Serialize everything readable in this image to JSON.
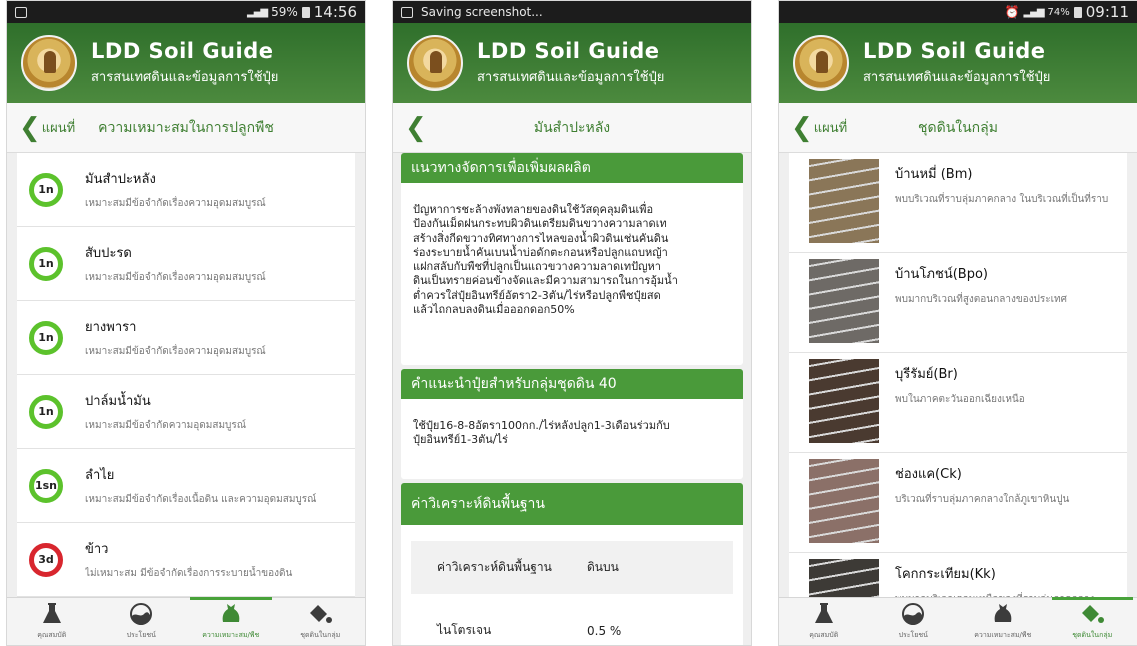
{
  "app": {
    "title": "LDD Soil Guide",
    "subtitle": "สารสนเทศดินและข้อมูลการใช้ปุ๋ย"
  },
  "tabs": [
    {
      "label": "คุณสมบัติ",
      "icon": "flask-icon"
    },
    {
      "label": "ประโยชน์",
      "icon": "soil-bowl-icon"
    },
    {
      "label": "ความเหมาะสม/พืช",
      "icon": "sack-icon"
    },
    {
      "label": "ชุดดินในกลุ่ม",
      "icon": "paint-bucket-icon"
    }
  ],
  "phone1": {
    "status_time": "14:56",
    "status_battery": "59%",
    "back_label": "แผนที่",
    "title": "ความเหมาะสมในการปลูกพืช",
    "active_tab": 2,
    "crops": [
      {
        "badge": "1n",
        "badge_color": "#5cc22c",
        "name": "มันสำปะหลัง",
        "desc": "เหมาะสมมีข้อจำกัดเรื่องความอุดมสมบูรณ์"
      },
      {
        "badge": "1n",
        "badge_color": "#5cc22c",
        "name": "สับปะรด",
        "desc": "เหมาะสมมีข้อจำกัดเรื่องความอุดมสมบูรณ์"
      },
      {
        "badge": "1n",
        "badge_color": "#5cc22c",
        "name": "ยางพารา",
        "desc": "เหมาะสมมีข้อจำกัดเรื่องความอุดมสมบูรณ์"
      },
      {
        "badge": "1n",
        "badge_color": "#5cc22c",
        "name": "ปาล์มน้ำมัน",
        "desc": "เหมาะสมมีข้อจำกัดความอุดมสมบูรณ์"
      },
      {
        "badge": "1sn",
        "badge_color": "#5cc22c",
        "name": "ลำไย",
        "desc": "เหมาะสมมีข้อจำกัดเรื่องเนื้อดิน และความอุดมสมบูรณ์"
      },
      {
        "badge": "3d",
        "badge_color": "#d8262e",
        "name": "ข้าว",
        "desc": "ไม่เหมาะสม มีข้อจำกัดเรื่องการระบายน้ำของดิน"
      }
    ]
  },
  "phone2": {
    "status_text": "Saving screenshot...",
    "title": "มันสำปะหลัง",
    "sections": [
      {
        "heading": "แนวทางจัดการเพื่อเพิ่มผลผลิต",
        "lines": [
          "ปัญหาการชะล้างพังทลายของดินใช้วัสดุคลุมดินเพื่อ",
          "ป้องกันเม็ดฝนกระทบผิวดินเตรียมดินขวางความลาดเท",
          "สร้างสิ่งกีดขวางทิศทางการไหลของน้ำผิวดินเช่นคันดิน",
          "ร่องระบายน้ำคันเบนน้ำบ่อดักตะกอนหรือปลูกแถบหญ้า",
          "แฝกสลับกับพืชที่ปลูกเป็นแถวขวางความลาดเทปัญหา",
          "ดินเป็นทรายค่อนข้างจัดและมีความสามารถในการอุ้มน้ำ",
          "ต่ำควรใส่ปุ๋ยอินทรีย์อัตรา2-3ตัน/ไร่หรือปลูกพืชปุ๋ยสด",
          "แล้วไถกลบลงดินเมื่อออกดอก50%"
        ]
      },
      {
        "heading": "คำแนะนำปุ๋ยสำหรับกลุ่มชุดดิน 40",
        "lines": [
          "ใช้ปุ๋ย16-8-8อัตรา100กก./ไร่หลังปลูก1-3เดือนร่วมกับ",
          "ปุ๋ยอินทรีย์1-3ตัน/ไร่"
        ]
      }
    ],
    "analysis": {
      "heading": "ค่าวิเคราะห์ดินพื้นฐาน",
      "col1": "ค่าวิเคราะห์ดินพื้นฐาน",
      "col2": "ดินบน",
      "rows": [
        {
          "name": "ไนโตรเจน",
          "value": "0.5 %"
        }
      ]
    }
  },
  "phone3": {
    "status_time": "09:11",
    "status_battery": "74%",
    "back_label": "แผนที่",
    "title": "ชุดดินในกลุ่ม",
    "active_tab": 3,
    "soils": [
      {
        "name": "บ้านหมี่ (Bm)",
        "desc": "พบบริเวณที่ราบลุ่มภาคกลาง ในบริเวณที่เป็นที่ราบ",
        "color": "#8a7658"
      },
      {
        "name": "บ้านโภชน์(Bpo)",
        "desc": "พบมากบริเวณที่สูงตอนกลางของประเทศ",
        "color": "#6e6a66"
      },
      {
        "name": "บุรีรัมย์(Br)",
        "desc": "พบในภาคตะวันออกเฉียงเหนือ",
        "color": "#4a3a30"
      },
      {
        "name": "ช่องแค(Ck)",
        "desc": "บริเวณที่ราบลุ่มภาคกลางใกล้ภูเขาหินปูน",
        "color": "#8b7068"
      },
      {
        "name": "โคกกระเทียม(Kk)",
        "desc": "พบมากบริเวณตอนเหนือของที่ราบลุ่มภาคกลาง",
        "color": "#3d3a36"
      }
    ]
  }
}
